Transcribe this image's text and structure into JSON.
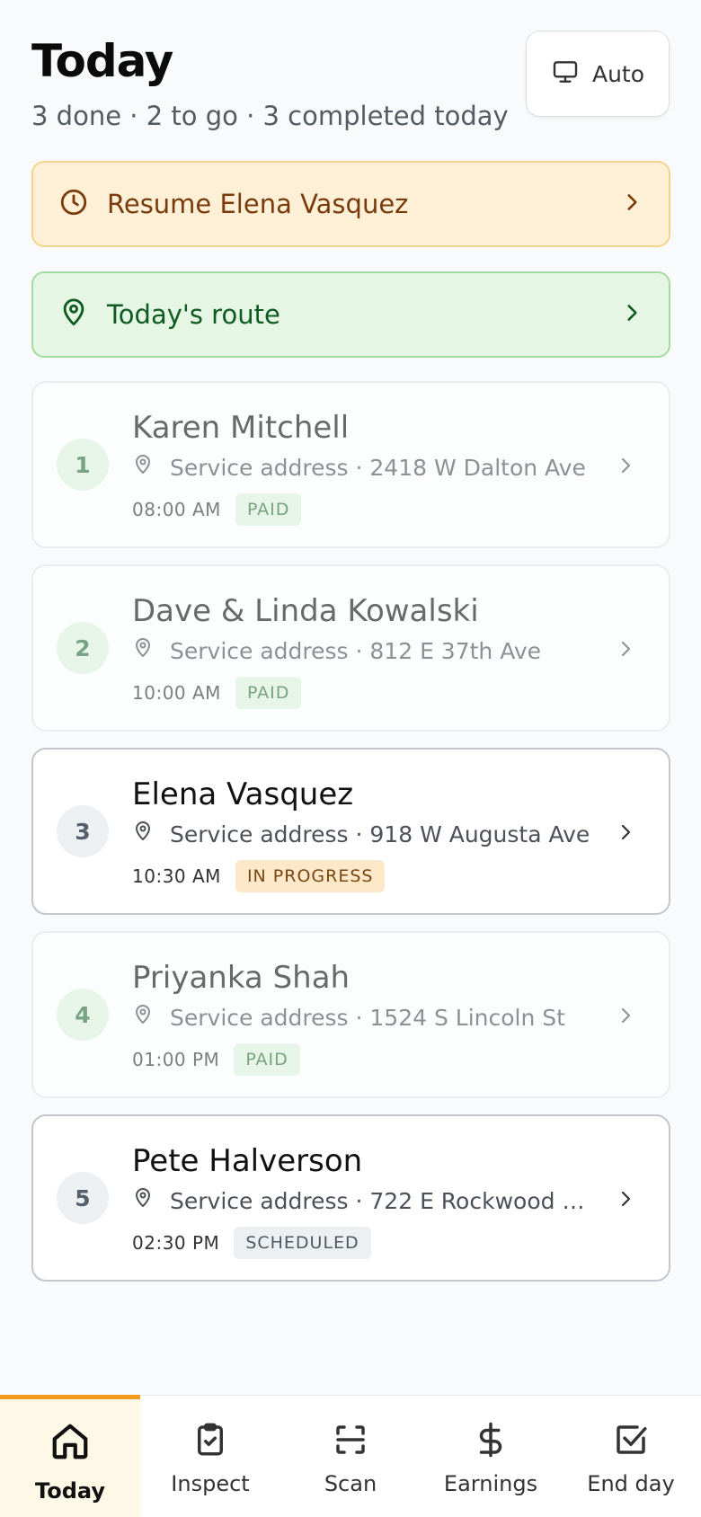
{
  "header": {
    "title": "Today",
    "summary": "3 done · 2 to go · 3 completed today",
    "mode_button": {
      "label": "Auto",
      "icon": "monitor-icon"
    }
  },
  "banners": {
    "resume": {
      "label": "Resume Elena Vasquez",
      "icon": "clock-icon",
      "color": "#7a3b0c"
    },
    "route": {
      "label": "Today's route",
      "icon": "map-pin-icon",
      "color": "#0f5b22"
    }
  },
  "jobs": [
    {
      "number": "1",
      "name": "Karen Mitchell",
      "address": "Service address · 2418 W Dalton Ave",
      "time": "08:00 AM",
      "status": "PAID"
    },
    {
      "number": "2",
      "name": "Dave & Linda Kowalski",
      "address": "Service address · 812 E 37th Ave",
      "time": "10:00 AM",
      "status": "PAID"
    },
    {
      "number": "3",
      "name": "Elena Vasquez",
      "address": "Service address · 918 W Augusta Ave",
      "time": "10:30 AM",
      "status": "IN PROGRESS"
    },
    {
      "number": "4",
      "name": "Priyanka Shah",
      "address": "Service address · 1524 S Lincoln St",
      "time": "01:00 PM",
      "status": "PAID"
    },
    {
      "number": "5",
      "name": "Pete Halverson",
      "address": "Service address · 722 E Rockwood B...",
      "time": "02:30 PM",
      "status": "SCHEDULED"
    }
  ],
  "tabbar": {
    "accent": "#f49a1c",
    "tabs": [
      {
        "label": "Today",
        "icon": "home-icon",
        "active": true
      },
      {
        "label": "Inspect",
        "icon": "clipboard-check-icon"
      },
      {
        "label": "Scan",
        "icon": "scan-icon"
      },
      {
        "label": "Earnings",
        "icon": "dollar-icon"
      },
      {
        "label": "End day",
        "icon": "checkbox-icon"
      }
    ]
  }
}
